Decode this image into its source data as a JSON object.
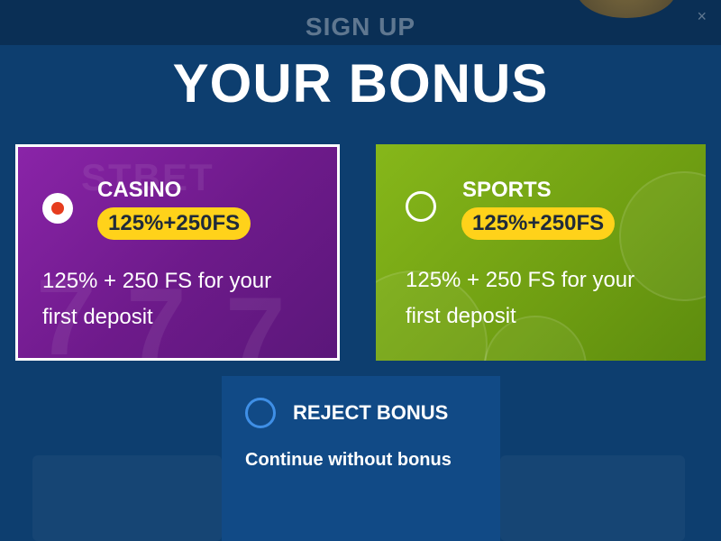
{
  "background": {
    "header_title": "SIGN UP",
    "close_symbol": "×"
  },
  "modal": {
    "title": "YOUR BONUS",
    "options": {
      "casino": {
        "name": "CASINO",
        "badge": "125%+250FS",
        "description_line1": "125% + 250 FS for your",
        "description_line2": "first deposit",
        "selected": true,
        "watermark": "STBET",
        "background_color": "#7c1f9c"
      },
      "sports": {
        "name": "SPORTS",
        "badge": "125%+250FS",
        "description_line1": "125% + 250 FS for your",
        "description_line2": "first deposit",
        "selected": false,
        "background_color": "#79a915"
      },
      "reject": {
        "name": "REJECT BONUS",
        "description": "Continue without bonus",
        "selected": false,
        "background_color": "#114a86"
      }
    }
  },
  "colors": {
    "overlay": "#0d3e6f",
    "badge": "#ffd21a",
    "radio_selected_dot": "#e63d1e",
    "reject_radio_ring": "#3f8fe6"
  }
}
